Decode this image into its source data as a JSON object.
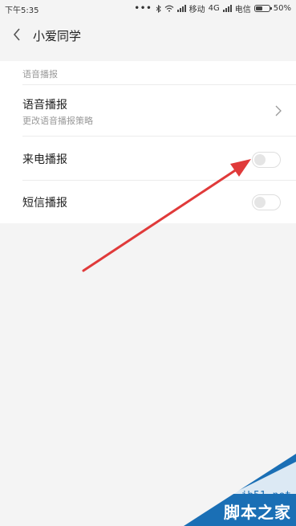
{
  "status_bar": {
    "time": "下午5:35",
    "carrier1": "移动",
    "network": "4G",
    "carrier2": "电信",
    "battery": "50%",
    "battery_level": 0.5
  },
  "header": {
    "title": "小爱同学",
    "back_icon": "chevron-left-icon"
  },
  "section": {
    "label": "语音播报"
  },
  "rows": [
    {
      "label": "语音播报",
      "sublabel": "更改语音播报策略",
      "control": "chevron-right-icon"
    },
    {
      "label": "来电播报",
      "control": "toggle",
      "checked": false
    },
    {
      "label": "短信播报",
      "control": "toggle",
      "checked": false
    }
  ],
  "annotation": {
    "color": "#e03a3a"
  },
  "watermark": {
    "url": "jb51.net",
    "text": "脚本之家"
  },
  "colors": {
    "background": "#f4f4f4",
    "panel": "#ffffff",
    "watermark_blue": "#1a6fb5"
  }
}
